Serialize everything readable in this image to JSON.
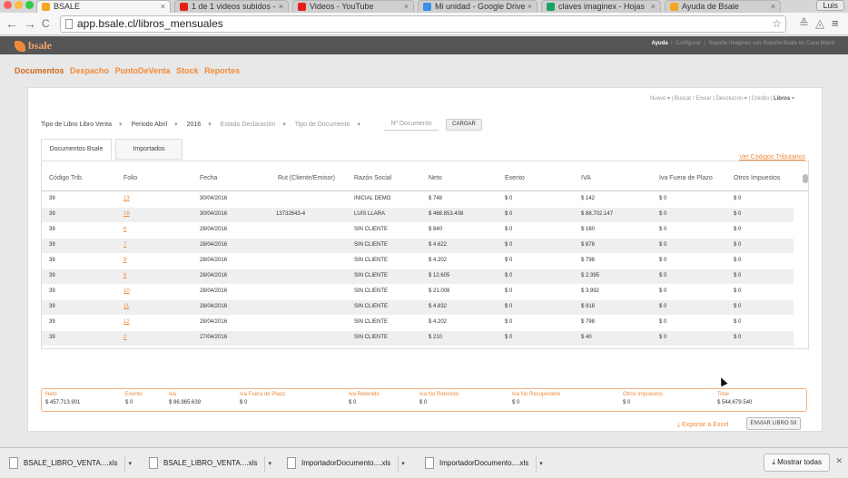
{
  "browser": {
    "tabs": [
      {
        "label": "BSALE",
        "active": true
      },
      {
        "label": "1 de 1 videos subidos -",
        "active": false
      },
      {
        "label": "Videos - YouTube",
        "active": false
      },
      {
        "label": "Mi unidad - Google Drive",
        "active": false
      },
      {
        "label": "claves imaginex - Hojas",
        "active": false
      },
      {
        "label": "Ayuda de Bsale",
        "active": false
      }
    ],
    "tab_close_glyph": "×",
    "user": "Luis",
    "url": "app.bsale.cl/libros_mensuales"
  },
  "appbar": {
    "logo": "bsale",
    "links": [
      "Ayuda",
      "Configurar",
      "Soporte Imaginex con Soporte Bsale en Casa Matriz"
    ]
  },
  "mainnav": [
    "Documentos",
    "Despacho",
    "PuntoDeVenta",
    "Stock",
    "Reportes"
  ],
  "subnav": [
    "Nuevo",
    "Buscar / Enviar",
    "Devolución",
    "Crédito",
    "Libros"
  ],
  "filters": {
    "tipo_libro": "Tipo de Libro Libro Venta",
    "periodo": "Periodo Abril",
    "anio": "2016",
    "estado": "Estado Declaración",
    "tipo_doc": "Tipo de Documento",
    "nro_placeholder": "Nº Documento",
    "cargar": "CARGAR"
  },
  "tabs": {
    "bsale": "Documentos Bsale",
    "importados": "Importados"
  },
  "ver_codigos": "Ver Códigos Tributarios",
  "table": {
    "headers": [
      "Código Trib.",
      "Folio",
      "Fecha",
      "Rut (Cliente/Emisor)",
      "Razón Social",
      "Neto",
      "Exento",
      "IVA",
      "Iva Fuera de Plazo",
      "Otros Impuestos"
    ],
    "rows": [
      [
        "39",
        "13",
        "30/04/2016",
        "",
        "INICIAL DEMO",
        "$ 748",
        "$ 0",
        "$ 142",
        "$ 0",
        "$ 0"
      ],
      [
        "39",
        "16",
        "30/04/2016",
        "13732643-4",
        "LUIS LLARA",
        "$ 466.853.408",
        "$ 0",
        "$ 88.702.147",
        "$ 0",
        "$ 0"
      ],
      [
        "39",
        "6",
        "28/04/2016",
        "",
        "SIN CLIENTE",
        "$ 840",
        "$ 0",
        "$ 160",
        "$ 0",
        "$ 0"
      ],
      [
        "39",
        "7",
        "28/04/2016",
        "",
        "SIN CLIENTE",
        "$ 4.622",
        "$ 0",
        "$ 878",
        "$ 0",
        "$ 0"
      ],
      [
        "39",
        "8",
        "28/04/2016",
        "",
        "SIN CLIENTE",
        "$ 4.202",
        "$ 0",
        "$ 798",
        "$ 0",
        "$ 0"
      ],
      [
        "39",
        "9",
        "28/04/2016",
        "",
        "SIN CLIENTE",
        "$ 12.605",
        "$ 0",
        "$ 2.395",
        "$ 0",
        "$ 0"
      ],
      [
        "39",
        "10",
        "28/04/2016",
        "",
        "SIN CLIENTE",
        "$ 21.008",
        "$ 0",
        "$ 3.992",
        "$ 0",
        "$ 0"
      ],
      [
        "39",
        "11",
        "28/04/2016",
        "",
        "SIN CLIENTE",
        "$ 4.832",
        "$ 0",
        "$ 918",
        "$ 0",
        "$ 0"
      ],
      [
        "39",
        "12",
        "28/04/2016",
        "",
        "SIN CLIENTE",
        "$ 4.202",
        "$ 0",
        "$ 798",
        "$ 0",
        "$ 0"
      ],
      [
        "39",
        "2",
        "27/04/2016",
        "",
        "SIN CLIENTE",
        "$ 210",
        "$ 0",
        "$ 40",
        "$ 0",
        "$ 0"
      ]
    ]
  },
  "totals": [
    {
      "label": "Neto",
      "value": "$ 457.713.901"
    },
    {
      "label": "Exento",
      "value": "$ 0"
    },
    {
      "label": "Iva",
      "value": "$ 86.965.639"
    },
    {
      "label": "Iva Fuera de Plazo",
      "value": "$ 0"
    },
    {
      "label": "Iva Retenido",
      "value": "$ 0"
    },
    {
      "label": "Iva No Retenido",
      "value": "$ 0"
    },
    {
      "label": "Iva No Recuperable",
      "value": "$ 0"
    },
    {
      "label": "Otros Impuestos",
      "value": "$ 0"
    },
    {
      "label": "Total",
      "value": "$ 544.679.540"
    }
  ],
  "exportar": "Exportar a Excel",
  "enviar": "ENVIAR LIBRO SII",
  "downloads": [
    "BSALE_LIBRO_VENTA....xls",
    "BSALE_LIBRO_VENTA....xls",
    "ImportadorDocumento....xls",
    "ImportadorDocumento....xls"
  ],
  "mostrar_todas": "Mostrar todas",
  "colors": {
    "accent": "#f08a3a",
    "appbar": "#555555",
    "youtube": "#e62117"
  }
}
